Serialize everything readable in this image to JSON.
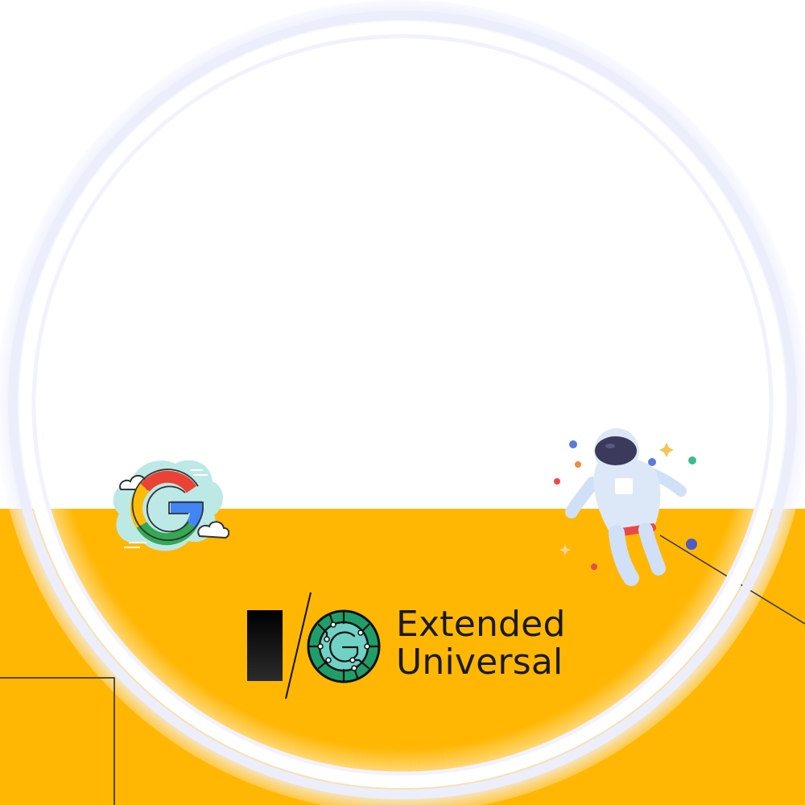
{
  "frame": {
    "brand": {
      "line1": "Extended",
      "line2": "Universal",
      "mark_letters": "I/O"
    },
    "colors": {
      "accent_yellow": "#FFB703",
      "ring": "#ECEDFA",
      "text": "#1a1a1a",
      "google_blue": "#4285F4",
      "google_red": "#EA4335",
      "google_yellow": "#FBBC05",
      "google_green": "#34A853"
    },
    "icons": [
      "google-g-cloud-icon",
      "astronaut-icon",
      "io-mark-icon",
      "circuit-g-icon"
    ]
  }
}
